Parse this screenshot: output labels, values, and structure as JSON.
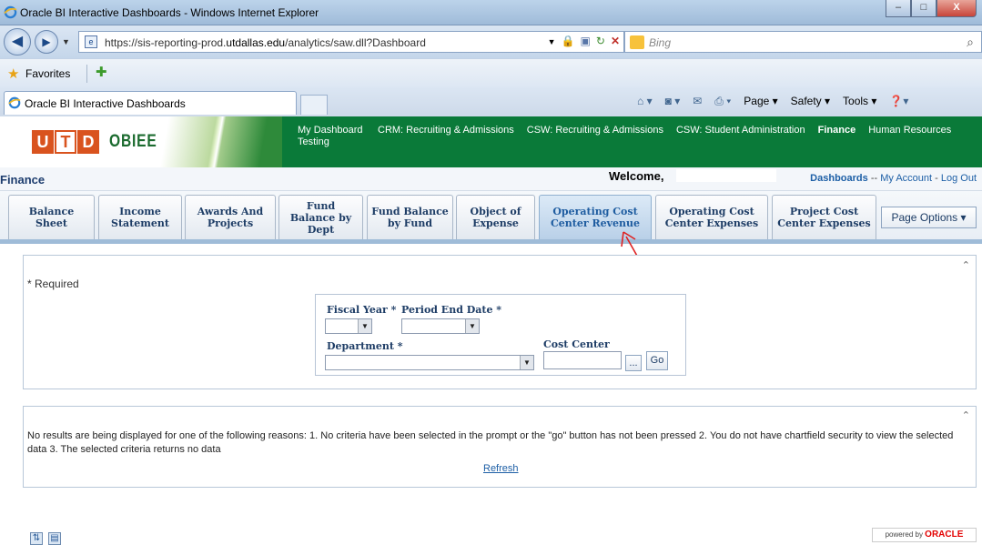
{
  "window": {
    "title": "Oracle BI Interactive Dashboards - Windows Internet Explorer",
    "minimize": "–",
    "maximize": "□",
    "close": "X"
  },
  "addressbar": {
    "url_prefix": "https://sis-reporting-prod.",
    "url_domain": "utdallas.edu",
    "url_suffix": "/analytics/saw.dll?Dashboard"
  },
  "searchbar": {
    "placeholder": "Bing"
  },
  "favorites": {
    "label": "Favorites"
  },
  "browser_tab": {
    "label": "Oracle BI Interactive Dashboards"
  },
  "commandbar": {
    "page": "Page ▾",
    "safety": "Safety ▾",
    "tools": "Tools ▾"
  },
  "brand": {
    "logo_u": "U",
    "logo_t": "T",
    "logo_d": "D",
    "product": "OBIEE"
  },
  "dashboards": [
    {
      "label": "My Dashboard Testing",
      "current": false
    },
    {
      "label": "CRM: Recruiting & Admissions",
      "current": false
    },
    {
      "label": "CSW: Recruiting & Admissions",
      "current": false
    },
    {
      "label": "CSW: Student Administration",
      "current": false
    },
    {
      "label": "Finance",
      "current": true
    },
    {
      "label": "Human Resources",
      "current": false
    }
  ],
  "subheader": {
    "section": "Finance",
    "welcome": "Welcome,",
    "dashboards_link": "Dashboards",
    "sep1": "--",
    "account_link": "My Account",
    "sep2": "-",
    "logout_link": "Log Out"
  },
  "page_tabs": [
    {
      "label": "Balance Sheet",
      "active": false
    },
    {
      "label": "Income Statement",
      "active": false
    },
    {
      "label": "Awards And Projects",
      "active": false
    },
    {
      "label": "Fund Balance by Dept",
      "active": false
    },
    {
      "label": "Fund Balance by Fund",
      "active": false
    },
    {
      "label": "Object of Expense",
      "active": false
    },
    {
      "label": "Operating Cost Center Revenue",
      "active": true
    },
    {
      "label": "Operating Cost Center Expenses",
      "active": false
    },
    {
      "label": "Project Cost Center Expenses",
      "active": false
    }
  ],
  "page_options": "Page Options ▾",
  "prompt": {
    "required_note": "* Required",
    "fiscal_year_label": "Fiscal Year *",
    "period_end_label": "Period End Date *",
    "department_label": "Department *",
    "cost_center_label": "Cost Center",
    "browse_button": "...",
    "go_button": "Go"
  },
  "results": {
    "message": "No results are being displayed for one of the following reasons: 1. No criteria have been selected in the prompt or the \"go\" button has not been pressed 2. You do not have chartfield security to view the selected data 3. The selected criteria returns no data",
    "refresh": "Refresh"
  },
  "footer": {
    "powered_by": "powered by",
    "oracle": "ORACLE"
  }
}
